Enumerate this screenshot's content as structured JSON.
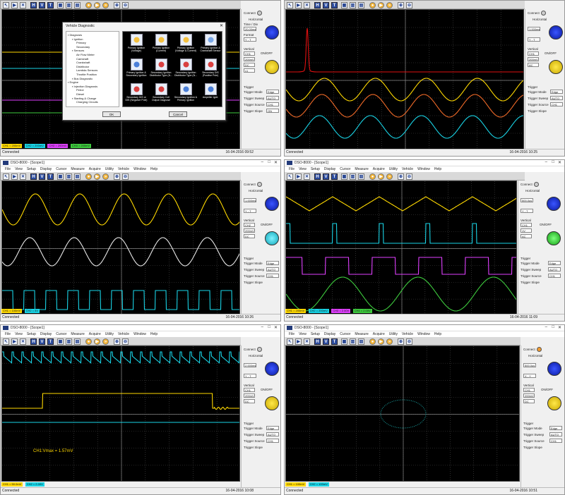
{
  "colors": {
    "ch1": "#ffd900",
    "ch2": "#19d4e6",
    "ch3": "#e040ff",
    "ch4": "#3ecb3e",
    "grid": "#4a4a4a",
    "math": "#e01010"
  },
  "app": {
    "window_title": "DSO-8000 - [Scope1]",
    "status_connected": "Connected",
    "date_1026": "16-04-2016  10:26",
    "date_1025": "16-04-2016  10:25",
    "date_0952": "16-04-2016  09:52",
    "date_1109": "16-04-2016  11:09",
    "date_1008": "16-04-2016  10:08",
    "date_1051": "16-04-2016  10:51",
    "move": "Move Waveform"
  },
  "menu": [
    "File",
    "View",
    "Setup",
    "Display",
    "Cursor",
    "Measure",
    "Acquire",
    "Utility",
    "Vehicle",
    "Window",
    "Help"
  ],
  "toolbar_icons": [
    "pointer-icon",
    "play-icon",
    "stop-icon",
    "H",
    "V",
    "T",
    "D",
    "single-icon",
    "scale-icon",
    "record-icon",
    "play-icon",
    "forward-icon",
    "zoom-in-icon",
    "zoom-out-icon"
  ],
  "side": {
    "connect": "Connect",
    "horizontal": "Horizontal",
    "timediv": "Time / Div",
    "format": "Format",
    "vertical": "Vertical",
    "onoff": "ON/OFF",
    "trigger": "Trigger",
    "mode": "Trigger Mode",
    "sweep": "Trigger Sweep",
    "source": "Trigger Source",
    "slope": "Trigger Slope",
    "edge": "Edge",
    "auto": "AUTO",
    "ch1": "CH1",
    "ch2": "CH2",
    "yt": "Y - T",
    "xy": "X - Y",
    "dc": "DC",
    "ac": "AC",
    "on": "ON",
    "v200": "200mV",
    "v1": "1V",
    "x1": "x1"
  },
  "panels": {
    "p1": {
      "time": "20.00ms",
      "status": "Auto",
      "timebar": "Time: 20.000ms",
      "chips": [
        "CH1 = 200mV",
        "CH2 = 200mV",
        "CH3 = 200mV",
        "CH4 = 200mV"
      ]
    },
    "p2": {
      "time": "1.000ms",
      "status": "High",
      "timebar": "Time: 1.000ms"
    },
    "p3": {
      "time": "1.000ms",
      "status": "High",
      "timebar": "Time: 1.000ms",
      "chips": [
        "CH1 = 100mV",
        "CH2 = 5V"
      ]
    },
    "p4": {
      "time": "500.0us",
      "status": "Auto",
      "timebar": "Time: 500.0us",
      "chips": [
        "CH1 = 200mV",
        "CH2 = 200mV",
        "CH3 = 2.00V",
        "CH4 = 2.00V"
      ]
    },
    "p5": {
      "time": "2.000ms",
      "status": "Auto",
      "timebar": "Time: 2.000ms",
      "chips": [
        "CH1 = 50.0mV",
        "CH2 = 2.00V"
      ],
      "readout": "CH1:Vmax = 1.57mV"
    },
    "p6": {
      "time": "500.0us",
      "status": "High",
      "timebar": "Time: 500.0us",
      "chips": [
        "CH1 = 100mV",
        "CH2 = 100mV"
      ],
      "cursor": "X = Y Mode"
    }
  },
  "dialog": {
    "title": "Vehicle Diagnostic",
    "tree": [
      "Diagnosis",
      "Ignition",
      "Primary",
      "Secondary",
      "Sensors",
      "Air Flow Meter",
      "Camshaft",
      "Crankshaft",
      "Distributor",
      "Lambda Sensors",
      "Throttle Position",
      "Bus Diagnostic",
      "Engine",
      "Injection Diagnosis",
      "Petrol",
      "Diesel",
      "Starting & Charge",
      "Charging Circuits"
    ],
    "tiles": [
      "Primary Ignition (Voltage)",
      "Primary Ignition (Current)",
      "Primary Ignition (Voltage & Current)",
      "Primary Ignition & Crankshaft Sensor",
      "Primary Ignition & Secondary Ignition",
      "Secondary Ignition Distributor Type (N...",
      "Secondary Ignition Distributor Type (N...",
      "Secondary DIS (Positive Pole)",
      "Secondary DIS or DIS (Negative Pole)",
      "Secondary Coil Output Diagnose",
      "Secondary Ignition & Primary Ignition",
      "Ampelier Ignit."
    ],
    "ok": "OK",
    "cancel": "Cancel"
  }
}
